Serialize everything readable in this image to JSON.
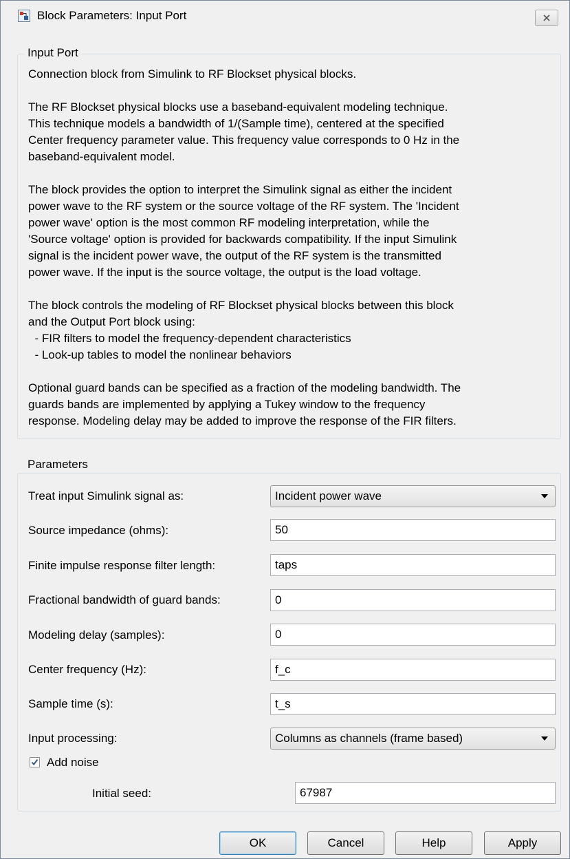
{
  "window": {
    "title": "Block Parameters: Input Port",
    "close_icon": "close-icon"
  },
  "description_group": {
    "legend": "Input Port",
    "paragraphs": [
      "Connection block from Simulink to RF Blockset physical blocks.",
      "The RF Blockset physical blocks use a baseband-equivalent modeling technique.\nThis technique models a bandwidth of 1/(Sample time), centered at the specified\nCenter frequency parameter value. This frequency value corresponds to 0 Hz in the\nbaseband-equivalent model.",
      "The block provides the option to interpret the Simulink signal as either the incident\npower wave to the RF system or the source voltage of the RF system. The 'Incident\npower wave' option is the most common RF modeling interpretation, while the\n'Source voltage' option is provided for backwards compatibility. If the input Simulink\nsignal is the incident power wave, the output of the RF system is the transmitted\npower wave. If the input is the source voltage, the output is the load voltage.",
      "The block controls the modeling of RF Blockset physical blocks between this block\nand the Output Port block using:\n  - FIR filters to model the frequency-dependent characteristics\n  - Look-up tables to model the nonlinear behaviors",
      "Optional guard bands can be specified as a fraction of the modeling bandwidth. The\nguards bands are implemented by applying a Tukey window to the frequency\nresponse. Modeling delay may be added to improve the response of the FIR filters."
    ]
  },
  "parameters_group": {
    "legend": "Parameters",
    "treat_input": {
      "label": "Treat input Simulink signal as:",
      "value": "Incident power wave"
    },
    "source_impedance": {
      "label": "Source impedance (ohms):",
      "value": "50"
    },
    "fir_length": {
      "label": "Finite impulse response filter length:",
      "value": "taps"
    },
    "guard_bands": {
      "label": "Fractional bandwidth of guard bands:",
      "value": "0"
    },
    "modeling_delay": {
      "label": "Modeling delay (samples):",
      "value": "0"
    },
    "center_frequency": {
      "label": "Center frequency (Hz):",
      "value": "f_c"
    },
    "sample_time": {
      "label": "Sample time (s):",
      "value": "t_s"
    },
    "input_processing": {
      "label": "Input processing:",
      "value": "Columns as channels (frame based)"
    },
    "add_noise": {
      "label": "Add noise",
      "checked": true
    },
    "initial_seed": {
      "label": "Initial seed:",
      "value": "67987"
    }
  },
  "buttons": {
    "ok": "OK",
    "cancel": "Cancel",
    "help": "Help",
    "apply": "Apply"
  }
}
